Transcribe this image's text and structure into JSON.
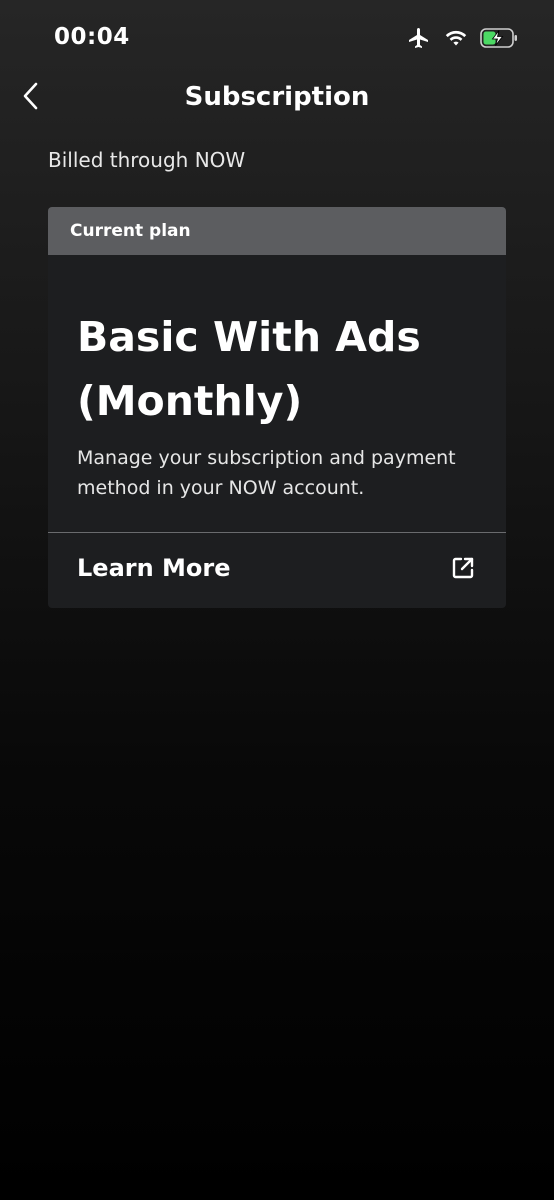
{
  "status_bar": {
    "time": "00:04",
    "icons": [
      "airplane-icon",
      "wifi-icon",
      "battery-charging-icon"
    ],
    "battery_color": "#4cd964"
  },
  "nav": {
    "title": "Subscription",
    "back_icon": "chevron-left-icon"
  },
  "billing": {
    "billed_through": "Billed through NOW"
  },
  "plan_card": {
    "header": "Current plan",
    "plan_name": "Basic With Ads (Monthly)",
    "description": "Manage your subscription and payment method in your NOW account.",
    "learn_more_label": "Learn More",
    "learn_more_icon": "external-link-icon"
  },
  "colors": {
    "card_background": "#1d1e20",
    "card_header_background": "#5c5d60"
  }
}
